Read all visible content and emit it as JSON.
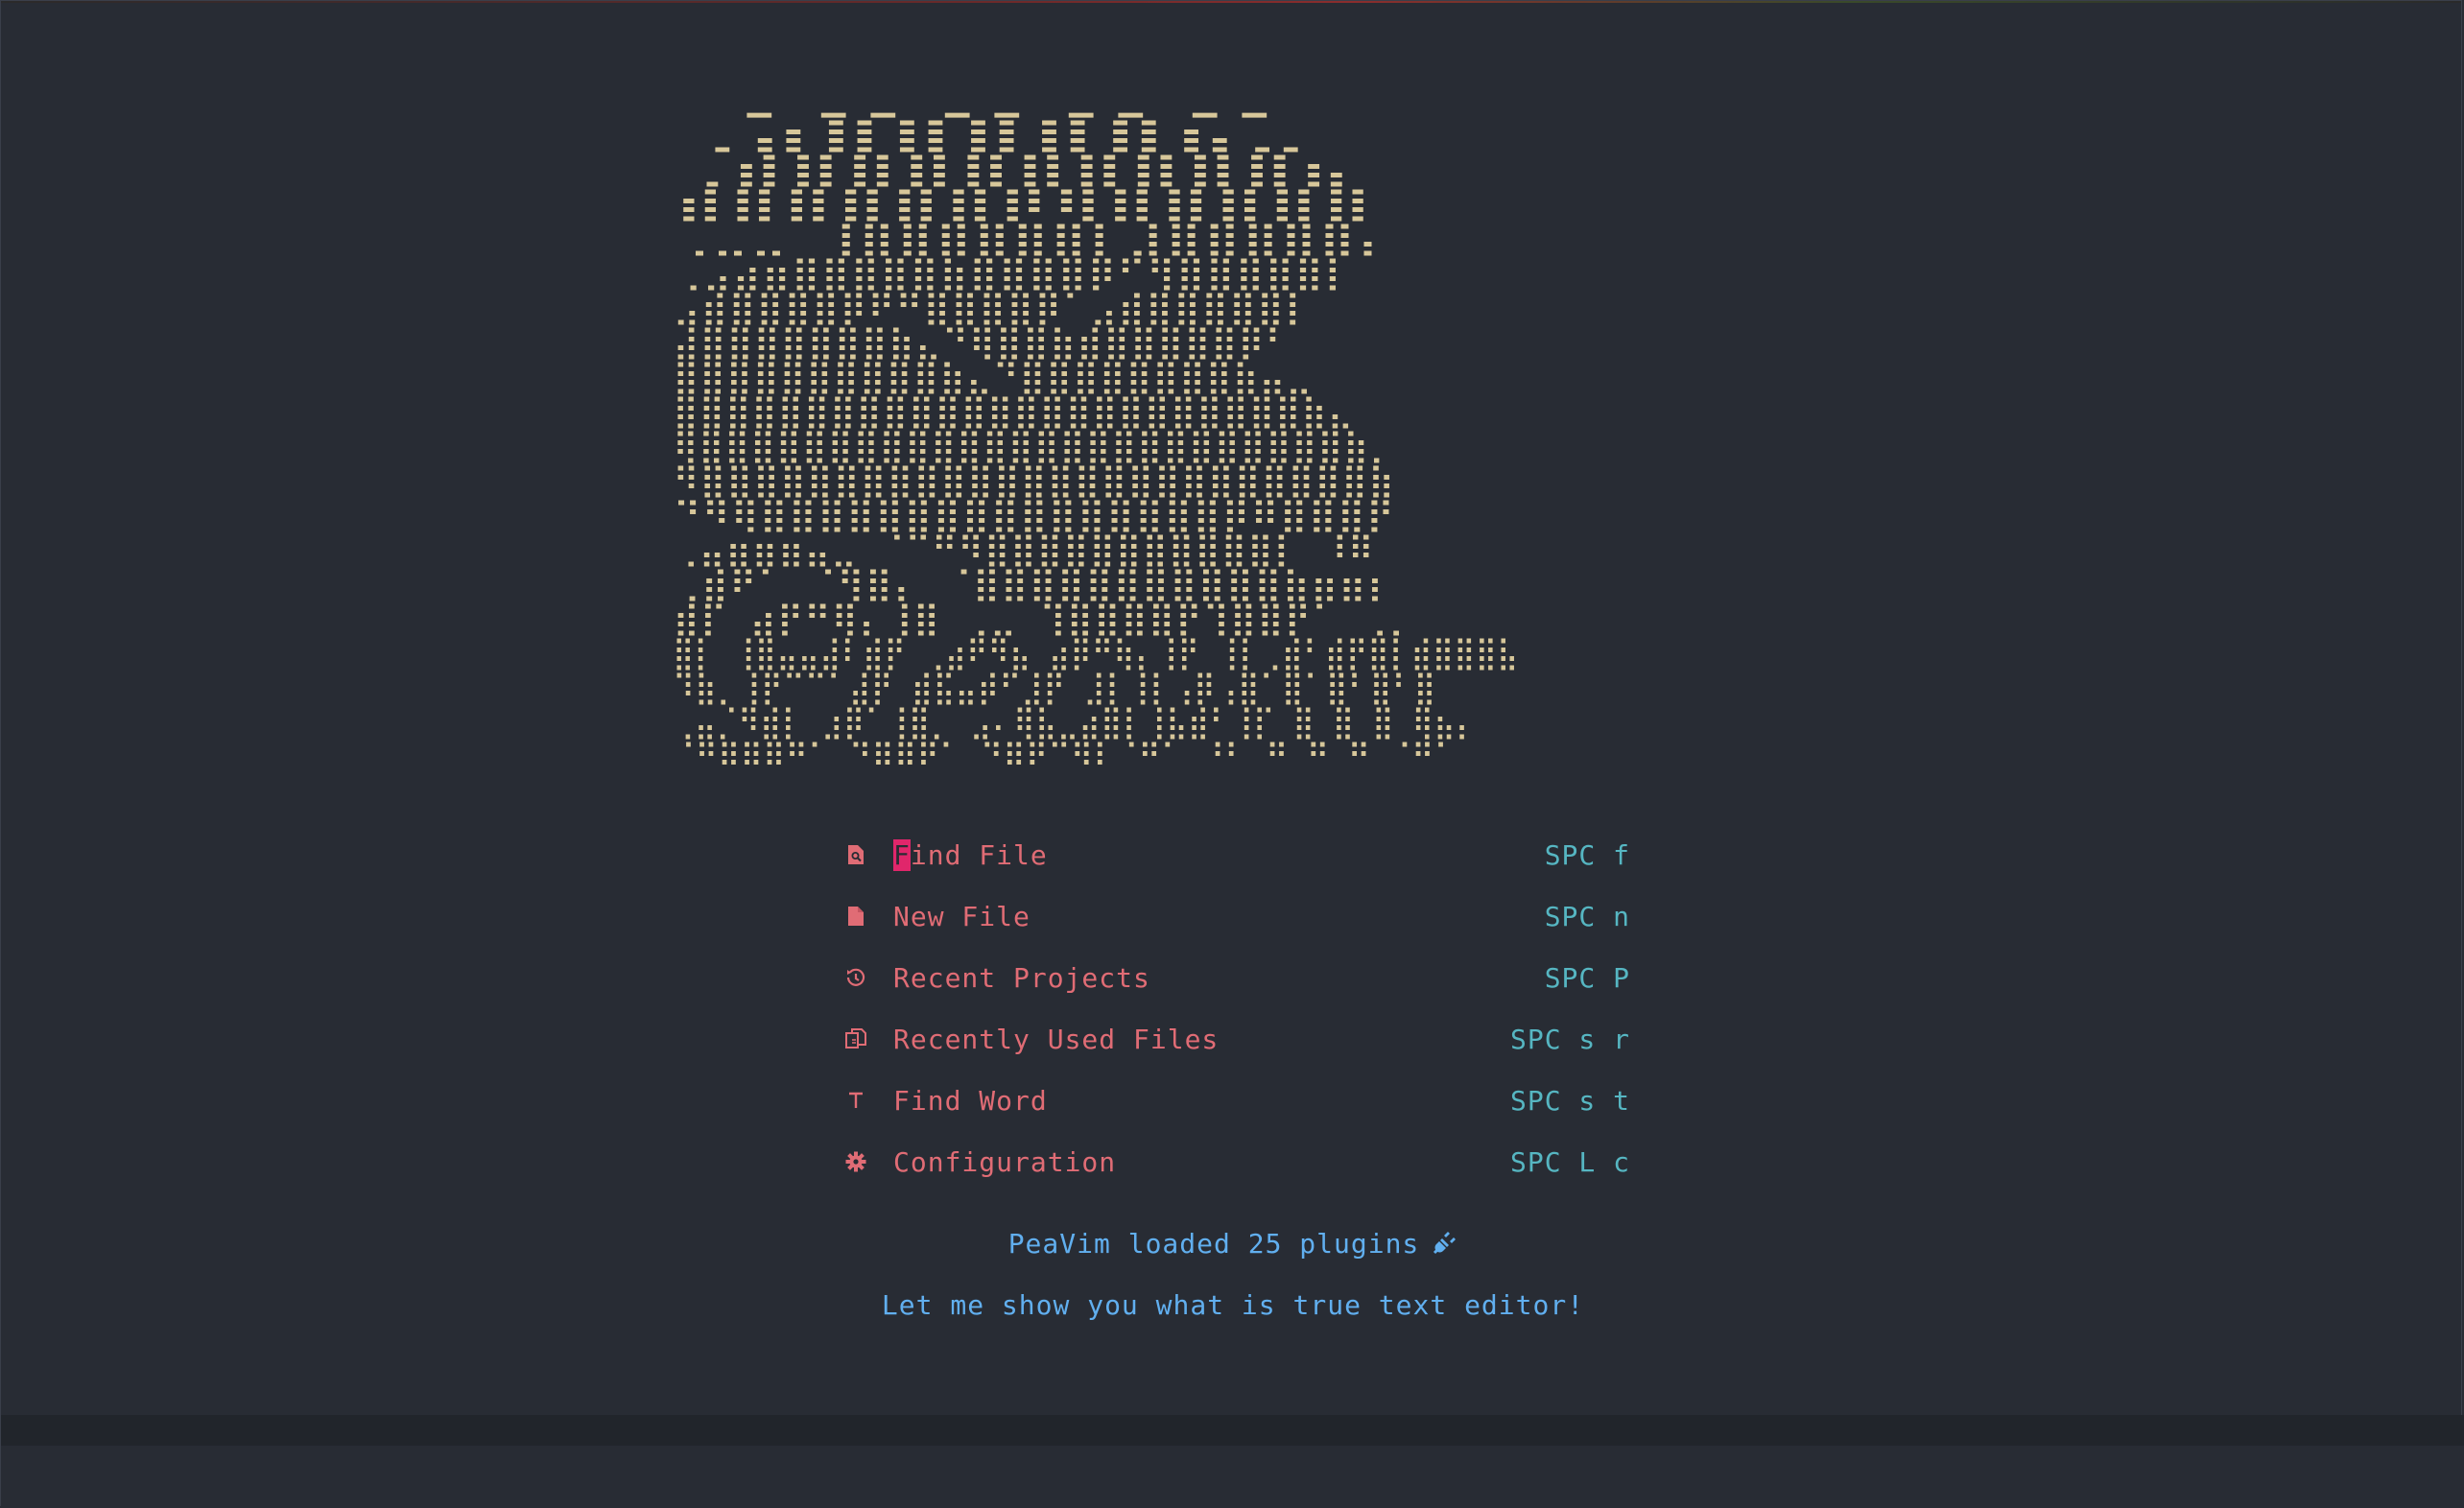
{
  "app": {
    "name": "PeaVim"
  },
  "logo": {
    "art_lines": [
      "                         ⢀⣀⣀⣀⣀",
      "                      ⢀⣴⣿⣿⣿⣿⣿⣦⣀",
      "                     ⢀⣾⣿⣿⣿⣿⣿⣿⣿⣿⣿⣦",
      "                     ⣾⣿⣿⣿⣿⣿⡿⢿⣿⣿⣿⣿⣿",
      "                ⢀⣀⣀ ⢸⣿⣿⣿⣿⣿⣿⡇⣸⣿⣿⣿⣿⣿⡄",
      "          ⢀⣠⣴⣶⣿⣿⣿⣿⣿⣷⣿⣿⣿⣿⡿⠋⢻⣿⣿⣿⣿⣿⡇",
      "        ⣠⣾⣿⣿⣿⣿⡿⠟⠛⣿⣿⣿⣿⡿⠁⣠⣾⣿⣿⣿⣿⣿⡇",
      "       ⣼⣿⣿⣿⣿⣿⣿⣿⣷⣄⠙⢿⣿⣿⣷⣾⣿⣿⣿⣿⣿⡿⠃",
      "       ⣿⣿⣿⣿⣿⣿⣿⣿⣿⣿⣷⣄⠙⣿⣿⣿⣿⣿⣿⣿⣿⣷⣤⣀",
      "       ⣿⣿⣿⣿⣿⣿⣿⣿⣿⣿⣿⣿⣿⣿⣿⣿⣿⣿⣿⣿⣿⣿⣿⣿⣷⣄",
      "       ⢿⣿⣿⣿⣿⣿⣿⣿⣿⣿⣿⣿⣿⣿⣿⣿⣿⣿⣿⣿⣿⣿⣿⣿⣿⣿⣷⡀",
      "        ⠻⣿⣿⣿⣿⣿⣿⣿⣿⣿⣿⣿⣿⣿⣿⣿⣿⣿⣿⣿⣿⣿⣿⣿⣿⣿⣷",
      "          ⠙⠻⢿⣿⣿⣿⣿⣿⣿⣿⣿⣿⣿⣿⣿⣿⣿⣿⣿⡿⠿⣿⣿⣿⡟",
      "   ⢀⣤⣶⣶⣶⣤⣀     ⠈⠉⠛⠻⣿⣿⣿⣿⣿⣿⣿⣿⣿⣿⣿⡇ ⠸⠿",
      " ⢀⣾⠟⠁  ⠈⢻⣿⡄        ⠈⣿⣿⣿⣿⣿⣿⣿⣿⣿⣿⣿⣷⣶⣶⡆",
      " ⣾⡏  ⣴⡟⠛⢿⡄⢸⣿       ⢀⣀ ⢹⣿⣿⣿⣿⡟⢹⣿⣿⡟⠁ ⢀⡀",
      " ⣿⡇ ⢸⣿⣤⣤⣼⠇⣾⡟ ⢀⣴⠟⠻⣦ ⣴⡿⠛⢷⡄⢸⡟ ⢸⡇⢀⣾⠃⣾⡟⣿⡇⣾⣿⣿⣿⣧",
      " ⠹⣷⡀⢸⡟⠉⠉⠁⣼⡟ ⣾⣯⣤⡾⠋⣸⡟  ⣸⡇⢸⡇⢠⡿⢠⣿⠁⣿⠁⣿⠃⣿⠃⣿",
      "⢀⣤⡈⠻⣾⡇  ⣰⡿⠁⢸⣿⡀ ⣠⠄⢿⣧⣀⣴⣿⡇⢸⣧⣾⠃⢸⡏ ⣿ ⣿ ⣿ ⢿⣦⡄",
      "⠈⠛⠿⠿⠿⠛⠁  ⠙⠿⠿⠟⠁  ⠙⠿⠟⠉⠻⠇⠈⠛⠁ ⠘⠃ ⠛ ⠛ ⠛ ⠈⠛⠁"
    ],
    "color": "#d7c79a"
  },
  "menu": {
    "items": [
      {
        "icon": "search-file-icon",
        "label_first": "F",
        "label_rest": "ind File",
        "key": "SPC f"
      },
      {
        "icon": "new-file-icon",
        "label": "New File",
        "key": "SPC n"
      },
      {
        "icon": "history-icon",
        "label": "Recent Projects",
        "key": "SPC P"
      },
      {
        "icon": "copy-files-icon",
        "label": "Recently Used Files",
        "key": "SPC s r"
      },
      {
        "icon": "text-icon",
        "label": "Find Word",
        "key": "SPC s t"
      },
      {
        "icon": "gear-icon",
        "label": "Configuration",
        "key": "SPC L c"
      }
    ]
  },
  "footer": {
    "loaded_text": "PeaVim loaded 25 plugins",
    "loaded_icon": "plug-icon",
    "tagline": "Let me show you what is true text editor!"
  },
  "colors": {
    "background": "#282c34",
    "menu_text": "#e06c75",
    "shortcut_text": "#56b6c2",
    "footer_text": "#61afef",
    "cursor": "#e0266b",
    "logo": "#d7c79a"
  }
}
